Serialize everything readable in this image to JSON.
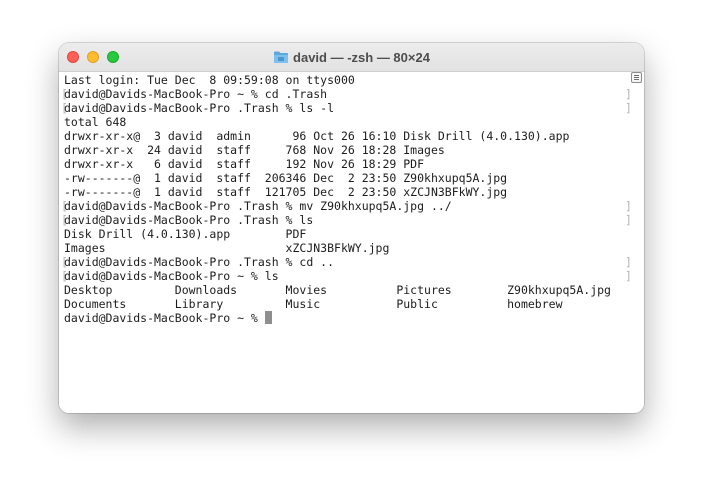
{
  "window": {
    "title": "david — -zsh — 80×24",
    "title_icon": "folder-icon"
  },
  "terminal": {
    "lines": [
      {
        "text": "Last login: Tue Dec  8 09:59:08 on ttys000",
        "prompt": false
      },
      {
        "text": "david@Davids-MacBook-Pro ~ % cd .Trash",
        "prompt": true
      },
      {
        "text": "david@Davids-MacBook-Pro .Trash % ls -l",
        "prompt": true
      },
      {
        "text": "total 648",
        "prompt": false
      },
      {
        "text": "drwxr-xr-x@  3 david  admin      96 Oct 26 16:10 Disk Drill (4.0.130).app",
        "prompt": false
      },
      {
        "text": "drwxr-xr-x  24 david  staff     768 Nov 26 18:28 Images",
        "prompt": false
      },
      {
        "text": "drwxr-xr-x   6 david  staff     192 Nov 26 18:29 PDF",
        "prompt": false
      },
      {
        "text": "-rw-------@  1 david  staff  206346 Dec  2 23:50 Z90khxupq5A.jpg",
        "prompt": false
      },
      {
        "text": "-rw-------@  1 david  staff  121705 Dec  2 23:50 xZCJN3BFkWY.jpg",
        "prompt": false
      },
      {
        "text": "david@Davids-MacBook-Pro .Trash % mv Z90khxupq5A.jpg ../",
        "prompt": true
      },
      {
        "text": "david@Davids-MacBook-Pro .Trash % ls",
        "prompt": true
      },
      {
        "text": "Disk Drill (4.0.130).app        PDF",
        "prompt": false
      },
      {
        "text": "Images                          xZCJN3BFkWY.jpg",
        "prompt": false
      },
      {
        "text": "david@Davids-MacBook-Pro .Trash % cd ..",
        "prompt": true
      },
      {
        "text": "david@Davids-MacBook-Pro ~ % ls",
        "prompt": true
      },
      {
        "text": "Desktop         Downloads       Movies          Pictures        Z90khxupq5A.jpg",
        "prompt": false
      },
      {
        "text": "Documents       Library         Music           Public          homebrew",
        "prompt": false
      }
    ],
    "current_prompt": "david@Davids-MacBook-Pro ~ % "
  }
}
